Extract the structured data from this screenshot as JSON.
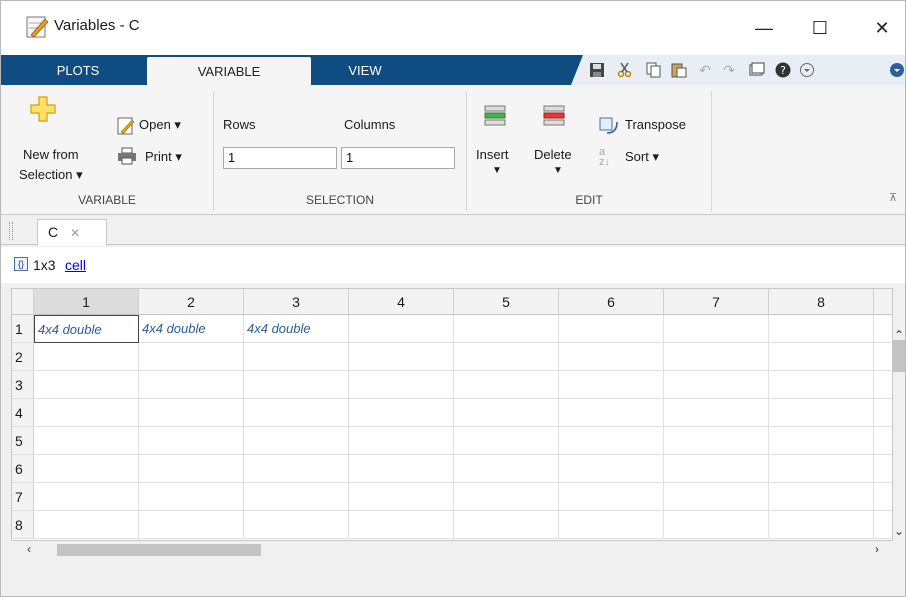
{
  "window": {
    "title": "Variables - C",
    "controls": {
      "minimize": "—",
      "maximize": "☐",
      "close": "✕"
    }
  },
  "tabs": [
    {
      "label": "PLOTS"
    },
    {
      "label": "VARIABLE"
    },
    {
      "label": "VIEW"
    }
  ],
  "ribbon": {
    "variable_group": {
      "new_from_selection": "New from",
      "new_from_selection_2": "Selection ▾",
      "open": "Open ▾",
      "print": "Print ▾",
      "label": "VARIABLE"
    },
    "selection_group": {
      "rows_label": "Rows",
      "columns_label": "Columns",
      "rows_value": "1",
      "columns_value": "1",
      "label": "SELECTION"
    },
    "edit_group": {
      "insert": "Insert",
      "delete": "Delete",
      "transpose": "Transpose",
      "sort": "Sort ▾",
      "label": "EDIT"
    }
  },
  "doc_tab": {
    "label": "C",
    "close": "✕"
  },
  "info": {
    "size": "1x3",
    "class": "cell"
  },
  "grid": {
    "col_headers": [
      "1",
      "2",
      "3",
      "4",
      "5",
      "6",
      "7",
      "8"
    ],
    "row_headers": [
      "1",
      "2",
      "3",
      "4",
      "5",
      "6",
      "7",
      "8"
    ],
    "row1": [
      "4x4 double",
      "4x4 double",
      "4x4 double"
    ]
  },
  "colors": {
    "tab_strip": "#0f4c81",
    "cell_text": "#2b5c9a"
  }
}
